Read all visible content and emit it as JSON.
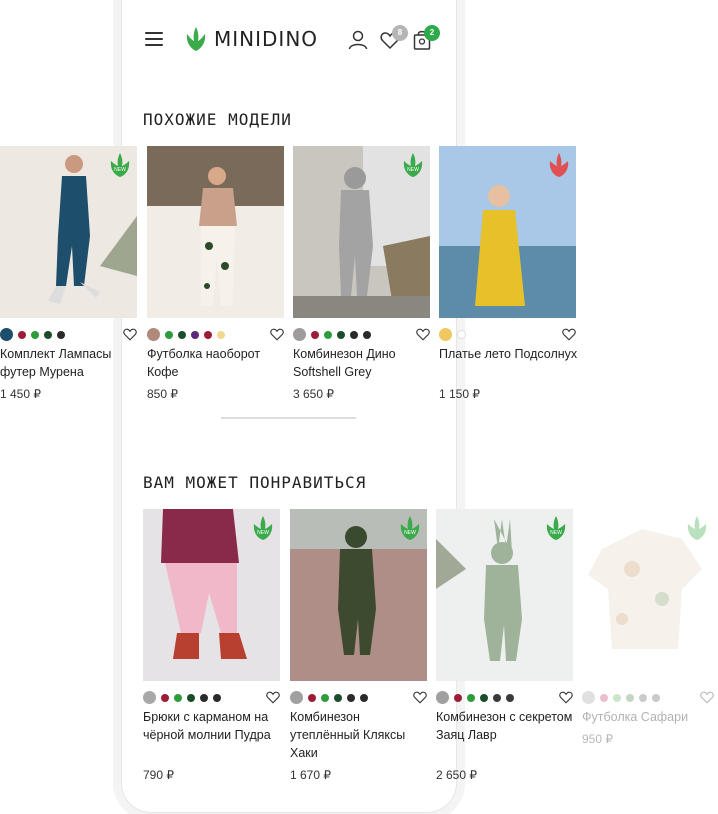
{
  "header": {
    "logo_text": "MINIDINO",
    "favorites_count": "8",
    "cart_count": "2"
  },
  "similar": {
    "title": "ПОХОЖИЕ МОДЕЛИ",
    "items": [
      {
        "name": "Комплект Лампасы футер Мурена",
        "price": "1 450 ₽",
        "new": true,
        "sale": false,
        "colors": [
          "#1d4e6b",
          "#9c1c3a",
          "#2e9c3d",
          "#1b4d2a",
          "#2a2a2a"
        ]
      },
      {
        "name": "Футболка наоборот Кофе",
        "price": "850 ₽",
        "new": false,
        "sale": false,
        "colors": [
          "#b08a78",
          "#2e9c3d",
          "#1b4d2a",
          "#5a2a7a",
          "#9c1c3a",
          "#f0d890"
        ]
      },
      {
        "name": "Комбинезон Дино Softshell Grey",
        "price": "3 650 ₽",
        "new": true,
        "sale": false,
        "colors": [
          "#a09a9a",
          "#9c1c3a",
          "#2e9c3d",
          "#1b4d2a",
          "#2a2a2a",
          "#2a2a2a"
        ]
      },
      {
        "name": "Платье лето Подсолнух",
        "price": "1 150 ₽",
        "new": false,
        "sale": true,
        "colors": [
          "#f0c860",
          "#ffffff"
        ]
      }
    ]
  },
  "recommended": {
    "title": "ВАМ МОЖЕТ ПОНРАВИТЬСЯ",
    "items": [
      {
        "name": "Брюки с карманом на чёрной молнии Пудра",
        "price": "790 ₽",
        "new": true,
        "colors": [
          "#a8a8a8",
          "#9c1c3a",
          "#2e9c3d",
          "#1b4d2a",
          "#2a2a2a",
          "#2a2a2a"
        ]
      },
      {
        "name": "Комбинезон утеплённый Кляксы Хаки",
        "price": "1 670 ₽",
        "new": true,
        "colors": [
          "#a0a0a0",
          "#9c1c3a",
          "#2e9c3d",
          "#1b4d2a",
          "#2a2a2a",
          "#2a2a2a"
        ]
      },
      {
        "name": "Комбинезон с секретом Заяц Лавр",
        "price": "2 650 ₽",
        "new": true,
        "colors": [
          "#a0a0a0",
          "#9c1c3a",
          "#2e9c3d",
          "#1b4d2a",
          "#3a3a3a",
          "#3a3a3a"
        ]
      },
      {
        "name": "Футболка Сафари",
        "price": "950 ₽",
        "new": true,
        "colors": [
          "#a8a8a8",
          "#c24a6a",
          "#6cb86a",
          "#5a8a5a",
          "#6a6a6a",
          "#6a6a6a"
        ]
      }
    ]
  },
  "colors": {
    "brand_green": "#3aaa4a",
    "badge_grey": "#b5b5b5",
    "cart_green": "#2eaa4a",
    "sale_red": "#e05050"
  }
}
